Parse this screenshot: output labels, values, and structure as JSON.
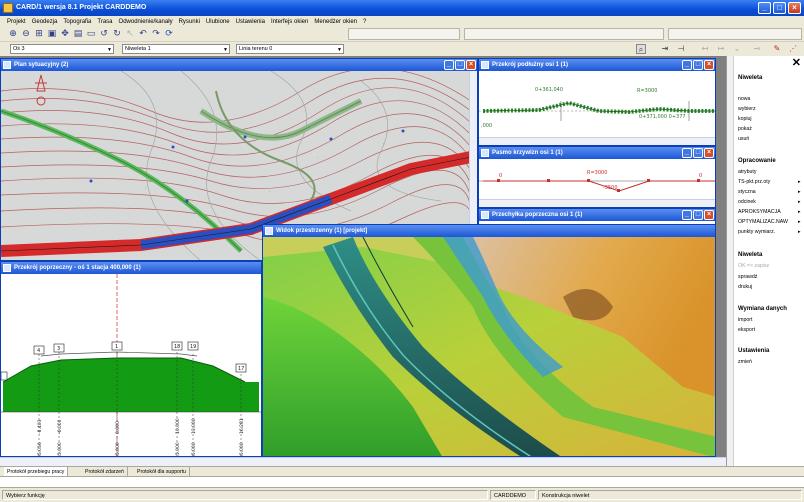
{
  "window": {
    "title": "CARD/1 wersja 8.1 Projekt CARDDEMO",
    "minimize": "_",
    "maximize": "□",
    "close": "×"
  },
  "menu": [
    "Projekt",
    "Geodezja",
    "Topografia",
    "Trasa",
    "Odwodnienie/kanały",
    "Rysunki",
    "Ulubione",
    "Ustawienia",
    "Interfejs okien",
    "Menedżer okien",
    "?"
  ],
  "toolbar": {
    "icons": [
      "zoom-in-icon",
      "zoom-out-icon",
      "zoom-extents-icon",
      "zoom-window-icon",
      "pan-icon",
      "redraw-icon",
      "rectangle-icon",
      "rotate-left-icon",
      "rotate-right-icon",
      "pointer-icon",
      "undo-icon",
      "redo-icon",
      "refresh-icon"
    ]
  },
  "selectors": {
    "axis": "Oś 3",
    "niweleta": "Niweleta 1",
    "terrain_line": "Linia terenu 0"
  },
  "windows": {
    "plan": {
      "title": "Plan sytuacyjny (2)"
    },
    "profile": {
      "title": "Przekrój podłużny osi 1 (1)",
      "labels": [
        "0+361,040",
        "R=3000",
        "0+371,000 0+377",
        ",000"
      ]
    },
    "curvature": {
      "title": "Pasmo krzywizn osi 1 (1)",
      "labels": [
        "0",
        "R=3000",
        "-3500",
        "0"
      ]
    },
    "superelev": {
      "title": "Przechyłka poprzeczna osi 1 (1)"
    },
    "cross": {
      "title": "Przekrój poprzeczny - oś 1 stacja 400,000 (1)",
      "markers": [
        "4",
        "3",
        "1",
        "18",
        "19",
        "17"
      ],
      "stations": [
        "-8.403",
        "-6.000",
        "-3.000",
        "0.000",
        "10.000",
        "13.000",
        "16.281"
      ],
      "elevs": [
        "35.056",
        "35.000",
        "35.000",
        "35.000",
        "35.000",
        "35.000",
        "35.000"
      ]
    },
    "view3d": {
      "title": "Widok przestrzenny (1) [projekt]"
    }
  },
  "panel": {
    "sec1": "Niweleta",
    "items1": [
      "nowa",
      "wybierz",
      "kopiuj",
      "pokaż",
      "usuń"
    ],
    "sec2": "Opracowanie",
    "items2": [
      {
        "label": "atrybuty",
        "arrow": ""
      },
      {
        "label": "TS-pkt.prz.oty",
        "arrow": "▸"
      },
      {
        "label": "styczna",
        "arrow": "▸"
      },
      {
        "label": "odcinek",
        "arrow": "▸"
      },
      {
        "label": "APROKSYMACJA",
        "arrow": "▸"
      },
      {
        "label": "OPTYMALIZAC.NAW",
        "arrow": "▸"
      },
      {
        "label": "punkty wymiarz.",
        "arrow": "▸"
      }
    ],
    "sec3": "Niweleta",
    "items3_disabled": "OK => zapisz",
    "items3": [
      "sprawdź",
      "drukuj"
    ],
    "sec4": "Wymiana danych",
    "items4": [
      "import",
      "eksport"
    ],
    "sec5": "Ustawienia",
    "items5": [
      "zmień"
    ]
  },
  "tabs": [
    "Protokół przebiegu pracy",
    "Protokół zdarzeń",
    "Protokół dla supportu"
  ],
  "status": {
    "hint": "Wybierz funkcję",
    "project": "CARDDEMO",
    "mode": "Konstrukcja niwelet"
  }
}
